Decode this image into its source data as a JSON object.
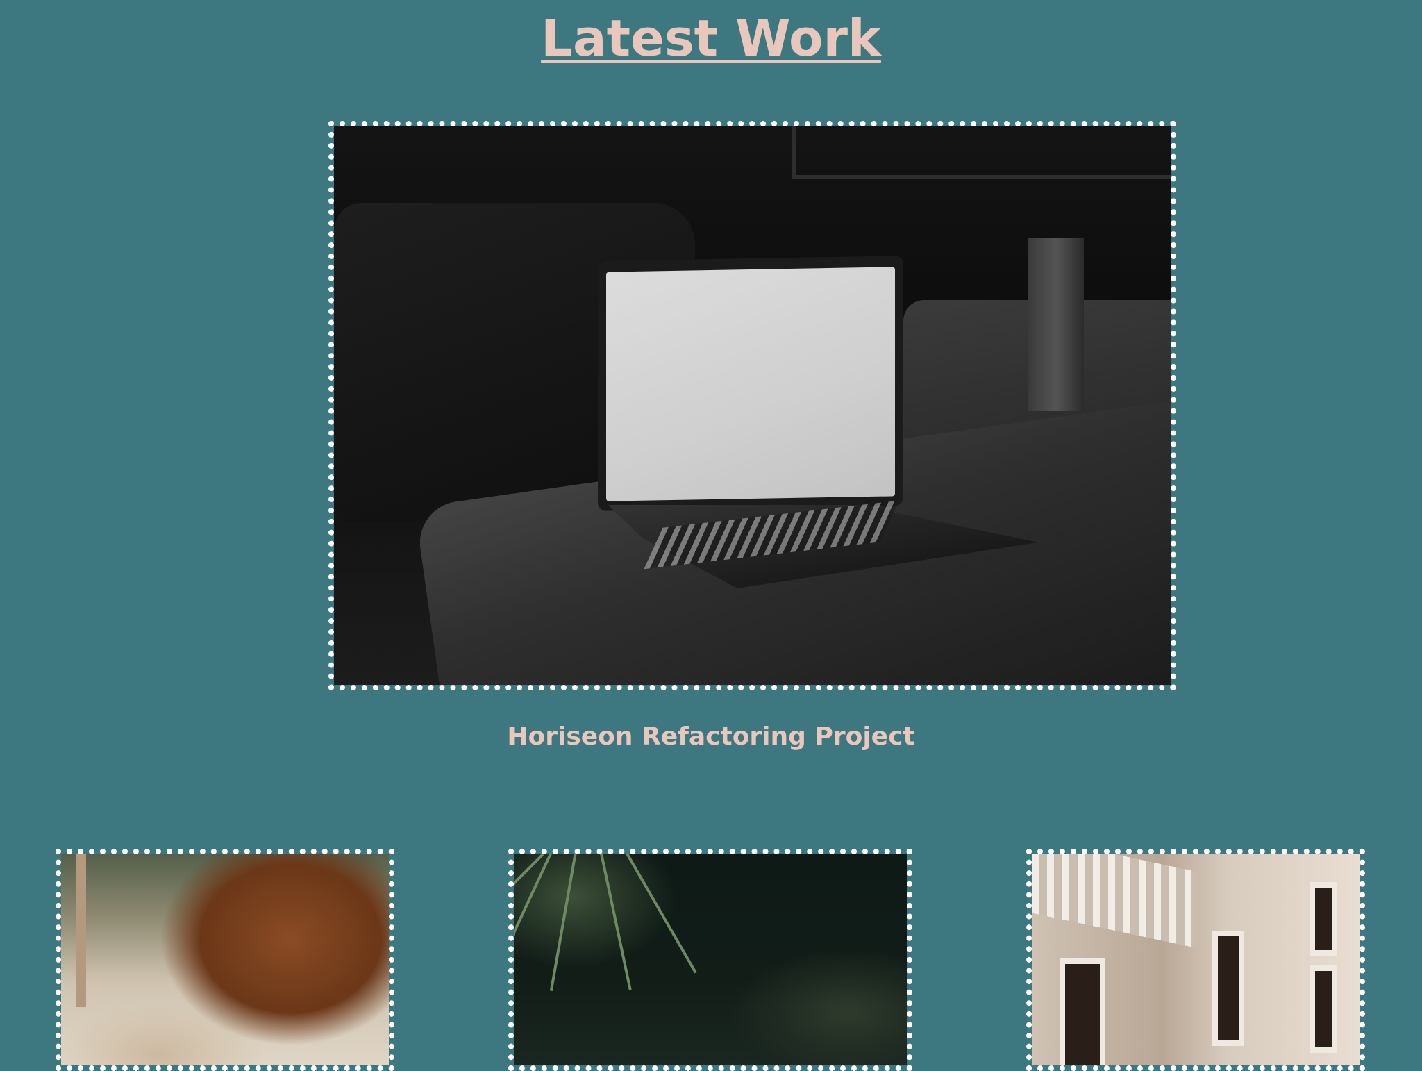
{
  "section": {
    "title": "Latest Work"
  },
  "featured": {
    "caption": "Horiseon Refactoring Project",
    "image_subject": "laptop-on-sofa-photo"
  },
  "projects": [
    {
      "image_subject": "person-in-brown-headscarf-photo"
    },
    {
      "image_subject": "dark-tropical-plants-photo"
    },
    {
      "image_subject": "white-building-facade-photo"
    }
  ],
  "colors": {
    "background": "#3d7880",
    "heading": "#eac7bc",
    "frame_border": "#ffffff"
  }
}
